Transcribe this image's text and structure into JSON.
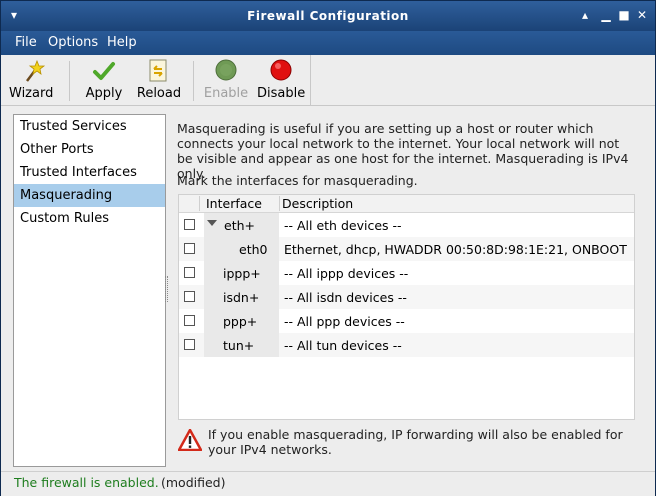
{
  "window": {
    "title": "Firewall Configuration"
  },
  "menu": [
    "File",
    "Options",
    "Help"
  ],
  "toolbar": {
    "wizard": "Wizard",
    "apply": "Apply",
    "reload": "Reload",
    "enable": "Enable",
    "disable": "Disable"
  },
  "sidebar": {
    "items": [
      {
        "label": "Trusted Services"
      },
      {
        "label": "Other Ports"
      },
      {
        "label": "Trusted Interfaces"
      },
      {
        "label": "Masquerading",
        "selected": true
      },
      {
        "label": "Custom Rules"
      }
    ]
  },
  "main": {
    "description": "Masquerading is useful if you are setting up a host or router which connects your local network to the internet. Your local network will not be visible and appear as one host for the internet. Masquerading is IPv4 only.",
    "instruction": "Mark the interfaces for masquerading.",
    "columns": [
      "Interface",
      "Description"
    ],
    "rows": [
      {
        "interface": "eth+",
        "description": "-- All eth devices --",
        "checked": false,
        "expanded": true
      },
      {
        "interface": "eth0",
        "description": "Ethernet, dhcp, HWADDR 00:50:8D:98:1E:21, ONBOOT",
        "checked": false
      },
      {
        "interface": "ippp+",
        "description": "-- All ippp devices --",
        "checked": false
      },
      {
        "interface": "isdn+",
        "description": "-- All isdn devices --",
        "checked": false
      },
      {
        "interface": "ppp+",
        "description": "-- All ppp devices --",
        "checked": false
      },
      {
        "interface": "tun+",
        "description": "-- All tun devices --",
        "checked": false
      }
    ],
    "warning": "If you enable masquerading, IP forwarding will also be enabled for your IPv4 networks."
  },
  "status": {
    "state": "The firewall is enabled.",
    "modified": "(modified)"
  },
  "colors": {
    "title_bar": "#1b4377",
    "selection": "#a8cdeb",
    "status_ok": "#1e7d1e",
    "disable_red": "#e01010"
  }
}
